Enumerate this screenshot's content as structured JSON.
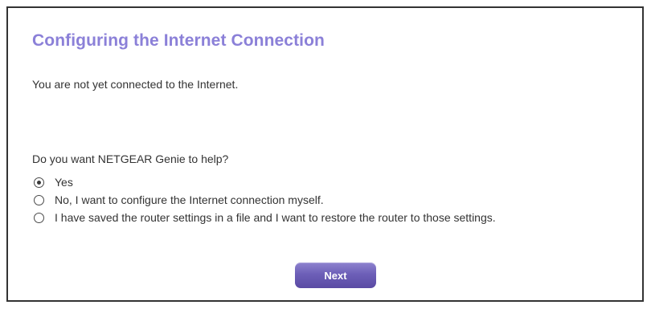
{
  "page": {
    "title": "Configuring the Internet Connection",
    "status_text": "You are not yet connected to the Internet.",
    "question": "Do you want NETGEAR Genie to help?"
  },
  "options": [
    {
      "label": "Yes",
      "selected": true
    },
    {
      "label": "No, I want to configure the Internet connection myself.",
      "selected": false
    },
    {
      "label": "I have saved the router settings in a file and I want to restore the router to those settings.",
      "selected": false
    }
  ],
  "actions": {
    "next_label": "Next"
  },
  "colors": {
    "title": "#8b80d8",
    "button": "#6d5fb8",
    "text": "#333333"
  }
}
